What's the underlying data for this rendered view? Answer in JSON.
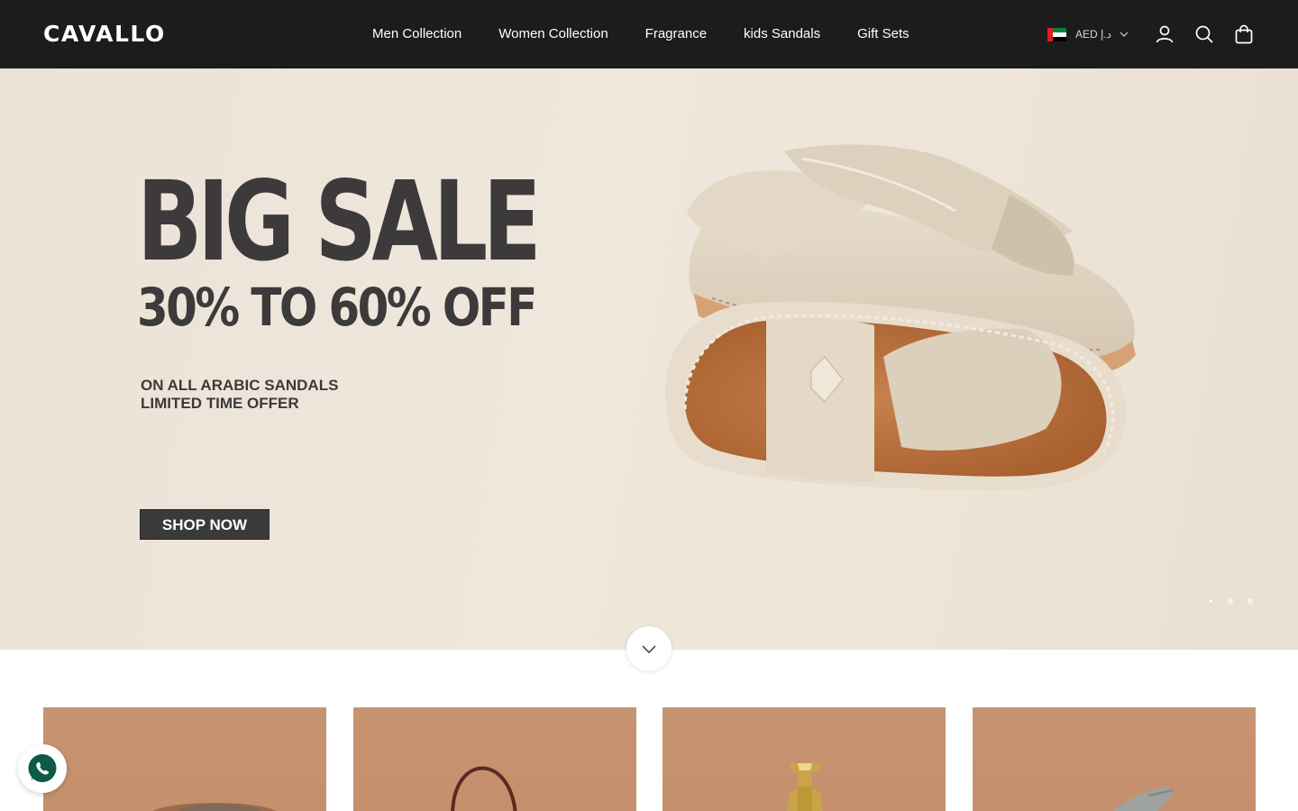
{
  "header": {
    "logo": "CAVALLO",
    "nav": [
      {
        "label": "Men Collection"
      },
      {
        "label": "Women Collection"
      },
      {
        "label": "Fragrance"
      },
      {
        "label": "kids Sandals"
      },
      {
        "label": "Gift Sets"
      }
    ],
    "currency": {
      "label": "AED د.إ",
      "flag": "uae-flag-icon"
    },
    "icons": [
      "account-icon",
      "search-icon",
      "cart-icon"
    ]
  },
  "hero": {
    "title": "BIG SALE",
    "subtitle": "30% TO 60% OFF",
    "line1": "ON ALL ARABIC SANDALS",
    "line2": "LIMITED TIME OFFER",
    "cta": "SHOP NOW",
    "slides": 3,
    "active_slide": 1
  },
  "products": {
    "count": 4,
    "items": [
      {
        "image": "sandal-product-image"
      },
      {
        "image": "bag-product-image"
      },
      {
        "image": "fragrance-product-image"
      },
      {
        "image": "sandal-grey-product-image"
      }
    ]
  },
  "colors": {
    "header_bg": "#1c1c1c",
    "hero_text": "#3c3a3a",
    "card_bg": "#c79472",
    "whatsapp": "#25d366"
  }
}
